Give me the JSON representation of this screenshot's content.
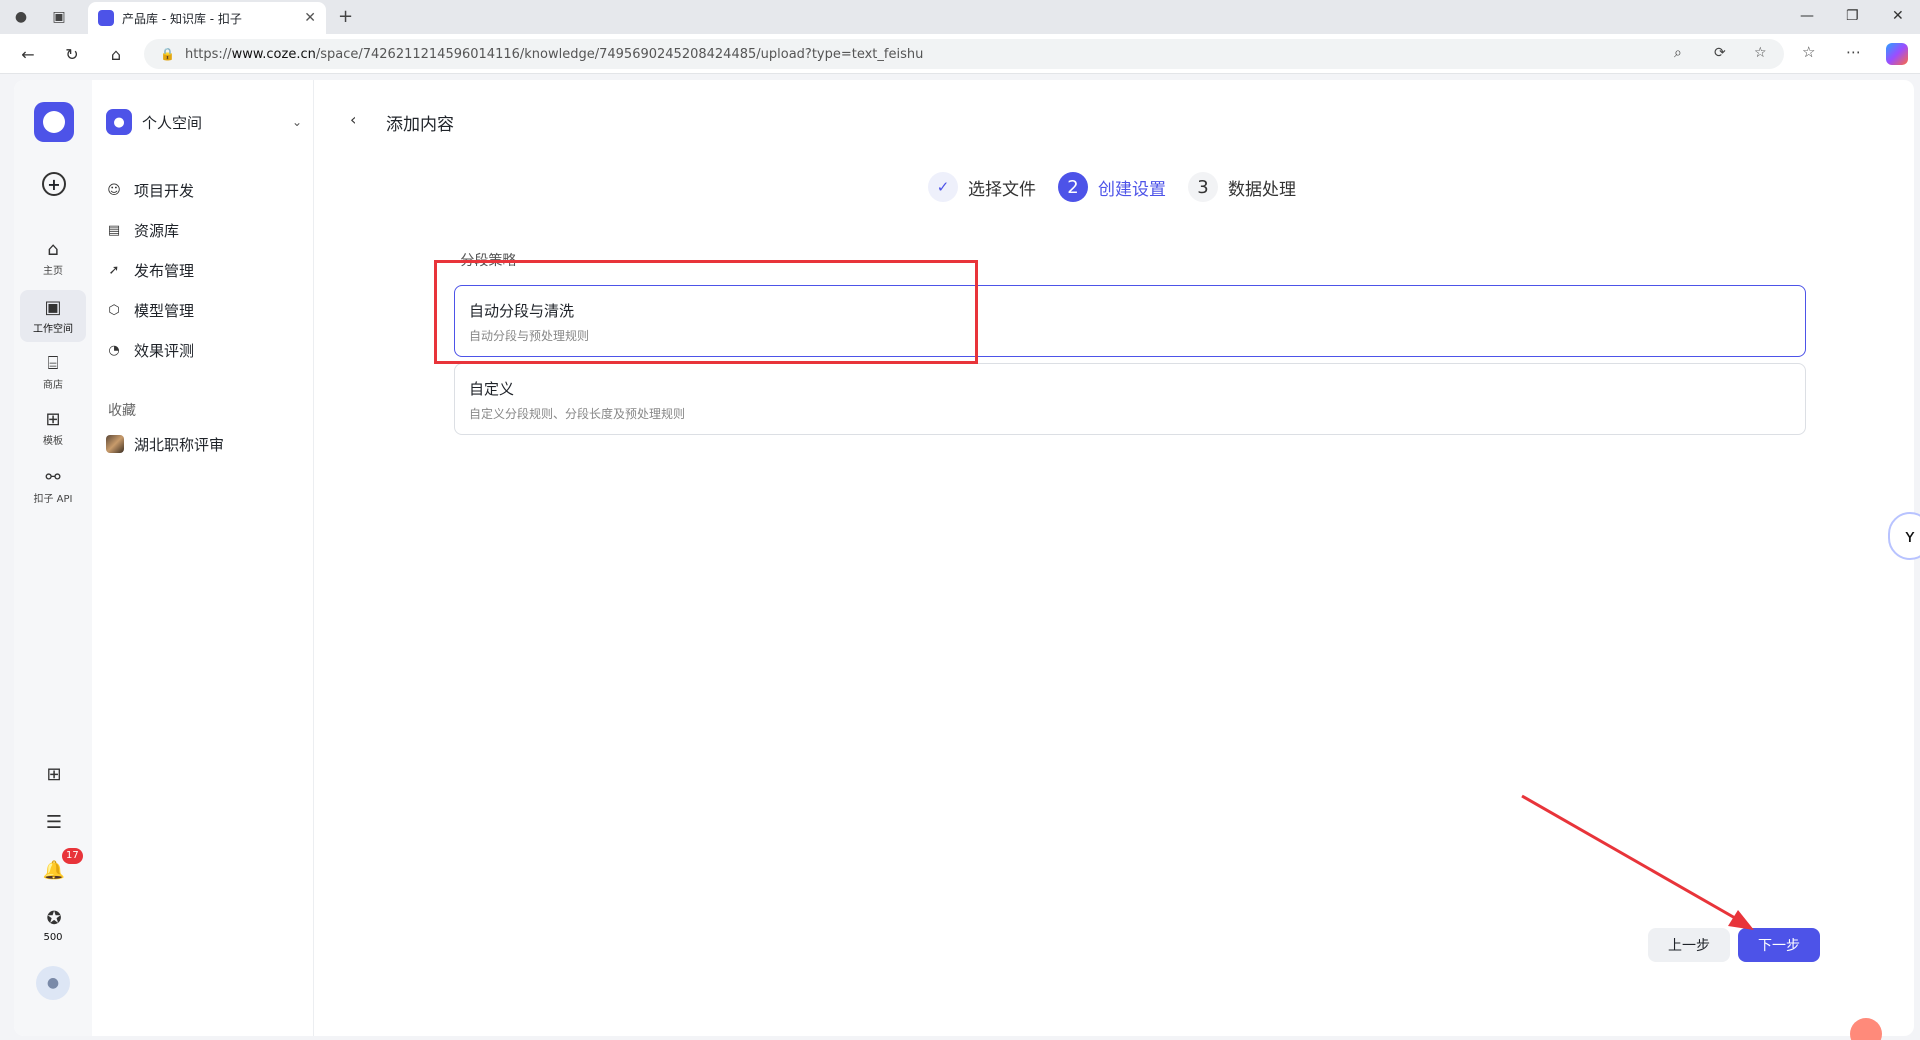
{
  "browser": {
    "tab_title": "产品库 - 知识库 - 扣子",
    "url_prefix": "https://",
    "url_host": "www.coze.cn",
    "url_path": "/space/7426211214596014116/knowledge/7495690245208424485/upload?type=text_feishu"
  },
  "rail": {
    "home": "主页",
    "workspace": "工作空间",
    "store": "商店",
    "templates": "模板",
    "api": "扣子 API",
    "notification_count": "17",
    "points": "500"
  },
  "sidebar": {
    "space_name": "个人空间",
    "items": [
      {
        "label": "项目开发",
        "icon": "bot-icon"
      },
      {
        "label": "资源库",
        "icon": "library-icon"
      },
      {
        "label": "发布管理",
        "icon": "rocket-icon"
      },
      {
        "label": "模型管理",
        "icon": "cube-icon"
      },
      {
        "label": "效果评测",
        "icon": "gauge-icon"
      }
    ],
    "favorites_heading": "收藏",
    "favorites": [
      {
        "label": "湖北职称评审"
      }
    ]
  },
  "main": {
    "title": "添加内容",
    "steps": [
      {
        "num": "✓",
        "label": "选择文件",
        "state": "done"
      },
      {
        "num": "2",
        "label": "创建设置",
        "state": "current"
      },
      {
        "num": "3",
        "label": "数据处理",
        "state": "todo"
      }
    ],
    "section_heading": "分段策略",
    "options": [
      {
        "title": "自动分段与清洗",
        "desc": "自动分段与预处理规则",
        "selected": true
      },
      {
        "title": "自定义",
        "desc": "自定义分段规则、分段长度及预处理规则",
        "selected": false
      }
    ],
    "prev_button": "上一步",
    "next_button": "下一步"
  },
  "colors": {
    "accent": "#4d53e8",
    "annotation_red": "#e8343a"
  }
}
